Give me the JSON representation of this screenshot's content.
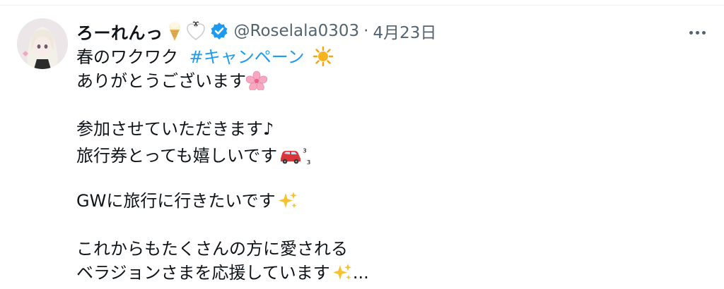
{
  "tweet": {
    "display_name": "ろーれんっ",
    "handle": "@Roselala0303",
    "separator": "·",
    "date": "4月23日",
    "lines": {
      "l1a": "春のワクワク",
      "hashtag": "#キャンペーン",
      "l2": "ありがとうございます",
      "l3": "参加させていただきます♪",
      "l4": "旅行券とっても嬉しいです",
      "sup": "³",
      "sub": "₃",
      "l5": "GWに旅行に行きたいです",
      "l6": "これからもたくさんの方に愛される",
      "l7a": "ベラジョンさまを応援しています",
      "l7b": "..."
    }
  },
  "icons": {
    "ice_cream": "ice-cream-emoji",
    "heart": "white-heart-emoji",
    "verified": "verified-badge-icon",
    "sun": "sun-emoji",
    "blossom": "cherry-blossom-emoji",
    "car": "car-emoji",
    "sparkles": "sparkles-emoji",
    "more": "more-options-icon"
  },
  "colors": {
    "link": "#1d9bf0",
    "muted": "#536471",
    "text": "#0f1419"
  }
}
